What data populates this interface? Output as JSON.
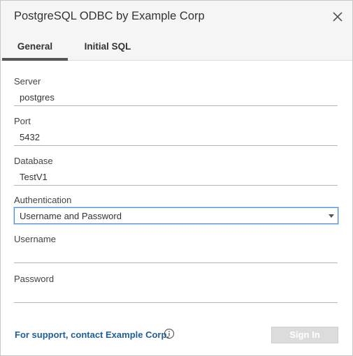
{
  "dialog": {
    "title": "PostgreSQL ODBC by Example Corp"
  },
  "tabs": [
    {
      "label": "General",
      "active": true
    },
    {
      "label": "Initial SQL",
      "active": false
    }
  ],
  "form": {
    "server": {
      "label": "Server",
      "value": "postgres"
    },
    "port": {
      "label": "Port",
      "value": "5432"
    },
    "database": {
      "label": "Database",
      "value": "TestV1"
    },
    "authentication": {
      "label": "Authentication",
      "selected": "Username and Password"
    },
    "username": {
      "label": "Username",
      "value": ""
    },
    "password": {
      "label": "Password",
      "value": ""
    }
  },
  "footer": {
    "support_text": "For support, contact Example Corp.",
    "signin_label": "Sign In",
    "signin_enabled": false
  },
  "icons": {
    "close": "close-icon",
    "info": "info-icon",
    "dropdown": "chevron-down-icon"
  },
  "colors": {
    "link": "#1f5e96",
    "focus_border": "#4a90d9",
    "disabled_button": "#dcdcdc",
    "tab_underline": "#555555"
  }
}
